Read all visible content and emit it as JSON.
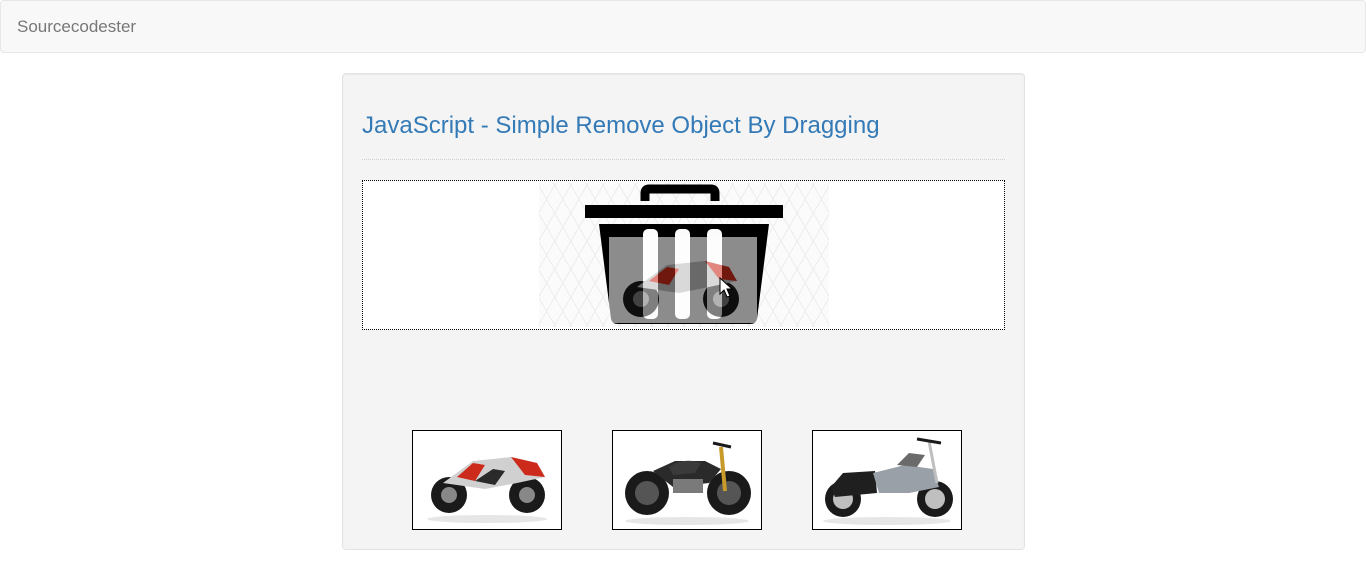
{
  "navbar": {
    "brand": "Sourcecodester"
  },
  "main": {
    "title": "JavaScript - Simple Remove Object By Dragging"
  },
  "dropzone": {
    "icon": "trash-can-icon",
    "dragged_item": "sport-motorcycle-image"
  },
  "thumbnails": [
    {
      "name": "sport-motorcycle-image",
      "accent": "#cc2a1a"
    },
    {
      "name": "naked-motorcycle-image",
      "accent": "#c89a2a"
    },
    {
      "name": "touring-motorcycle-image",
      "accent": "#9aa0a8"
    }
  ],
  "colors": {
    "title": "#337ab7",
    "brand": "#777777",
    "panel": "#f4f4f4"
  }
}
